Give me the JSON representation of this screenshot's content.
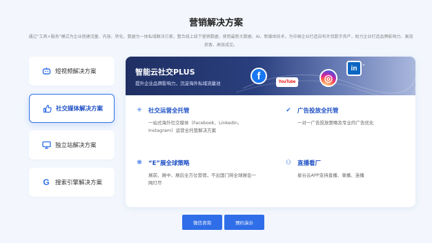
{
  "header": {
    "title": "营销解决方案",
    "description": "通过“工具+服务”模式为企业搭建流量、内容、转化、数据为一体私域解决方案，整合线上线下营销数据，使用最新大数据、AI、新媒体技术，为中国企业打造自有外贸数字资产，助力企业打造品牌影响力、高效获客、高效成交。"
  },
  "sidebar": {
    "items": [
      {
        "label": "短视频解决方案",
        "icon": "robot-icon",
        "active": false
      },
      {
        "label": "社交媒体解决方案",
        "icon": "thumbs-up-icon",
        "active": true
      },
      {
        "label": "独立站解决方案",
        "icon": "monitor-icon",
        "active": false
      },
      {
        "label": "搜索引擎解决方案",
        "icon": "google-icon",
        "active": false
      }
    ]
  },
  "banner": {
    "title": "智能云社交PLUS",
    "subtitle": "提升企业品牌影响力，沉淀海外私域流量池",
    "logos": [
      {
        "name": "facebook-icon",
        "text": "f",
        "color": "#1877f2"
      },
      {
        "name": "youtube-icon",
        "text": "YouTube",
        "color": "#ff0000"
      },
      {
        "name": "instagram-icon",
        "text": "◎",
        "color": "#d6249f"
      },
      {
        "name": "linkedin-icon",
        "text": "in",
        "color": "#0a66c2"
      }
    ]
  },
  "features": [
    {
      "title": "社交运营全托管",
      "text": "一站式海外社交媒体（Facebook、Linkedin、Instagram）运营全托管解决方案",
      "icon": "sparkle-icon"
    },
    {
      "title": "广告投放全托管",
      "text": "一对一广告投放策略及专业的广告优化",
      "icon": "ad-check-icon"
    },
    {
      "title": "“E”展全球策略",
      "text": "展前、展中、展后全方位营销，不出国门将全球展会一网打尽",
      "icon": "globe-icon"
    },
    {
      "title": "直播看厂",
      "text": "星谷云APP支持直播、录播、连播",
      "icon": "live-icon"
    }
  ],
  "buttons": {
    "consult": "微信咨询",
    "demo": "预约演示"
  },
  "colors": {
    "accent": "#2f6ee8",
    "background": "#f3f7fd"
  }
}
